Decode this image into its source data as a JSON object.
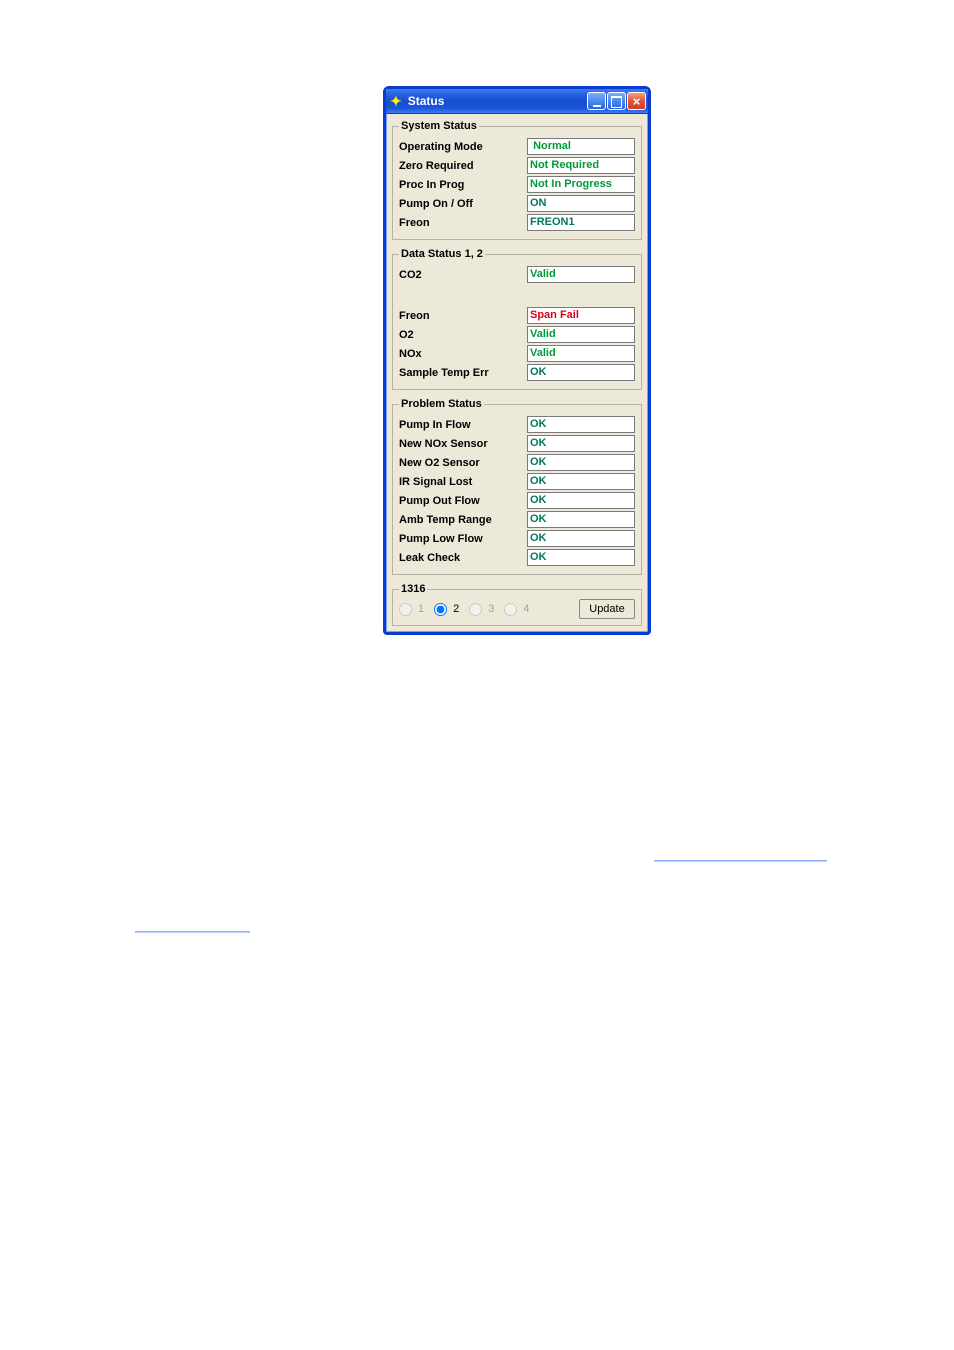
{
  "window": {
    "title": "Status",
    "icon_glyph": "✦"
  },
  "system_status": {
    "legend": "System Status",
    "operating_mode": {
      "label": "Operating Mode",
      "value": "Normal"
    },
    "zero_required": {
      "label": "Zero Required",
      "value": "Not Required"
    },
    "proc_in_prog": {
      "label": "Proc In Prog",
      "value": "Not In Progress"
    },
    "pump": {
      "label": "Pump On / Off",
      "value": "ON"
    },
    "freon": {
      "label": "Freon",
      "value": "FREON1"
    }
  },
  "data_status": {
    "legend": "Data Status 1, 2",
    "co2": {
      "label": "CO2",
      "value": "Valid"
    },
    "freon": {
      "label": "Freon",
      "value": "Span Fail"
    },
    "o2": {
      "label": "O2",
      "value": "Valid"
    },
    "nox": {
      "label": "NOx",
      "value": "Valid"
    },
    "sample_temp": {
      "label": "Sample Temp Err",
      "value": "OK"
    }
  },
  "problem_status": {
    "legend": "Problem Status",
    "pump_in_flow": {
      "label": "Pump In Flow",
      "value": "OK"
    },
    "new_nox_sensor": {
      "label": "New NOx Sensor",
      "value": "OK"
    },
    "new_o2_sensor": {
      "label": "New O2 Sensor",
      "value": "OK"
    },
    "ir_signal_lost": {
      "label": "IR Signal Lost",
      "value": "OK"
    },
    "pump_out_flow": {
      "label": "Pump Out Flow",
      "value": "OK"
    },
    "amb_temp_range": {
      "label": "Amb Temp Range",
      "value": "OK"
    },
    "pump_low_flow": {
      "label": "Pump Low Flow",
      "value": "OK"
    },
    "leak_check": {
      "label": "Leak Check",
      "value": "OK"
    }
  },
  "port_group": {
    "legend": "1316",
    "options": [
      "1",
      "2",
      "3",
      "4"
    ],
    "selected": "2",
    "update_label": "Update"
  }
}
